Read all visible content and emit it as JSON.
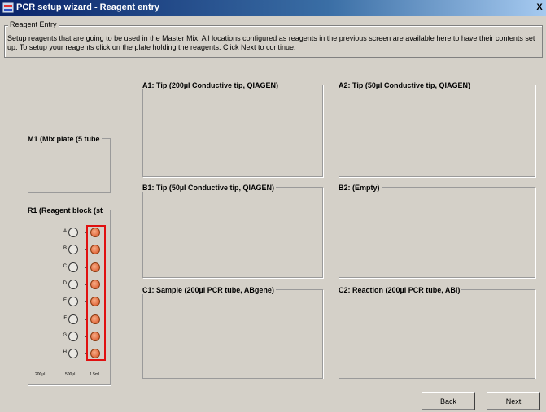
{
  "window": {
    "title": "PCR setup wizard - Reagent entry",
    "close_label": "X"
  },
  "reagent_entry": {
    "group_title": "Reagent Entry",
    "description": "Setup reagents that are going to be used in the Master Mix. All locations configured as reagents in the previous screen are available here to have their contents set up. To setup your reagents click on the plate holding the reagents. Click Next to continue."
  },
  "panels": {
    "m1": "M1 (Mix plate (5 tube",
    "r1": "R1 (Reagent block (st",
    "a1": "A1: Tip (200µl Conductive tip, QIAGEN)",
    "a2": "A2: Tip (50µl Conductive tip, QIAGEN)",
    "b1": "B1: Tip (50µl Conductive tip, QIAGEN)",
    "b2": "B2: (Empty)",
    "c1": "C1: Sample (200µl PCR tube, ABgene)",
    "c2": "C2: Reaction (200µl PCR tube, ABI)"
  },
  "reagent_block": {
    "rows": [
      "A",
      "B",
      "C",
      "D",
      "E",
      "F",
      "G",
      "H"
    ],
    "columns": [
      "200µl",
      "500µl",
      "1.5ml"
    ],
    "selected_column": "1.5ml",
    "colors": {
      "filled": "#e0663a",
      "selection": "#e01010"
    }
  },
  "buttons": {
    "back": "Back",
    "next": "Next"
  }
}
